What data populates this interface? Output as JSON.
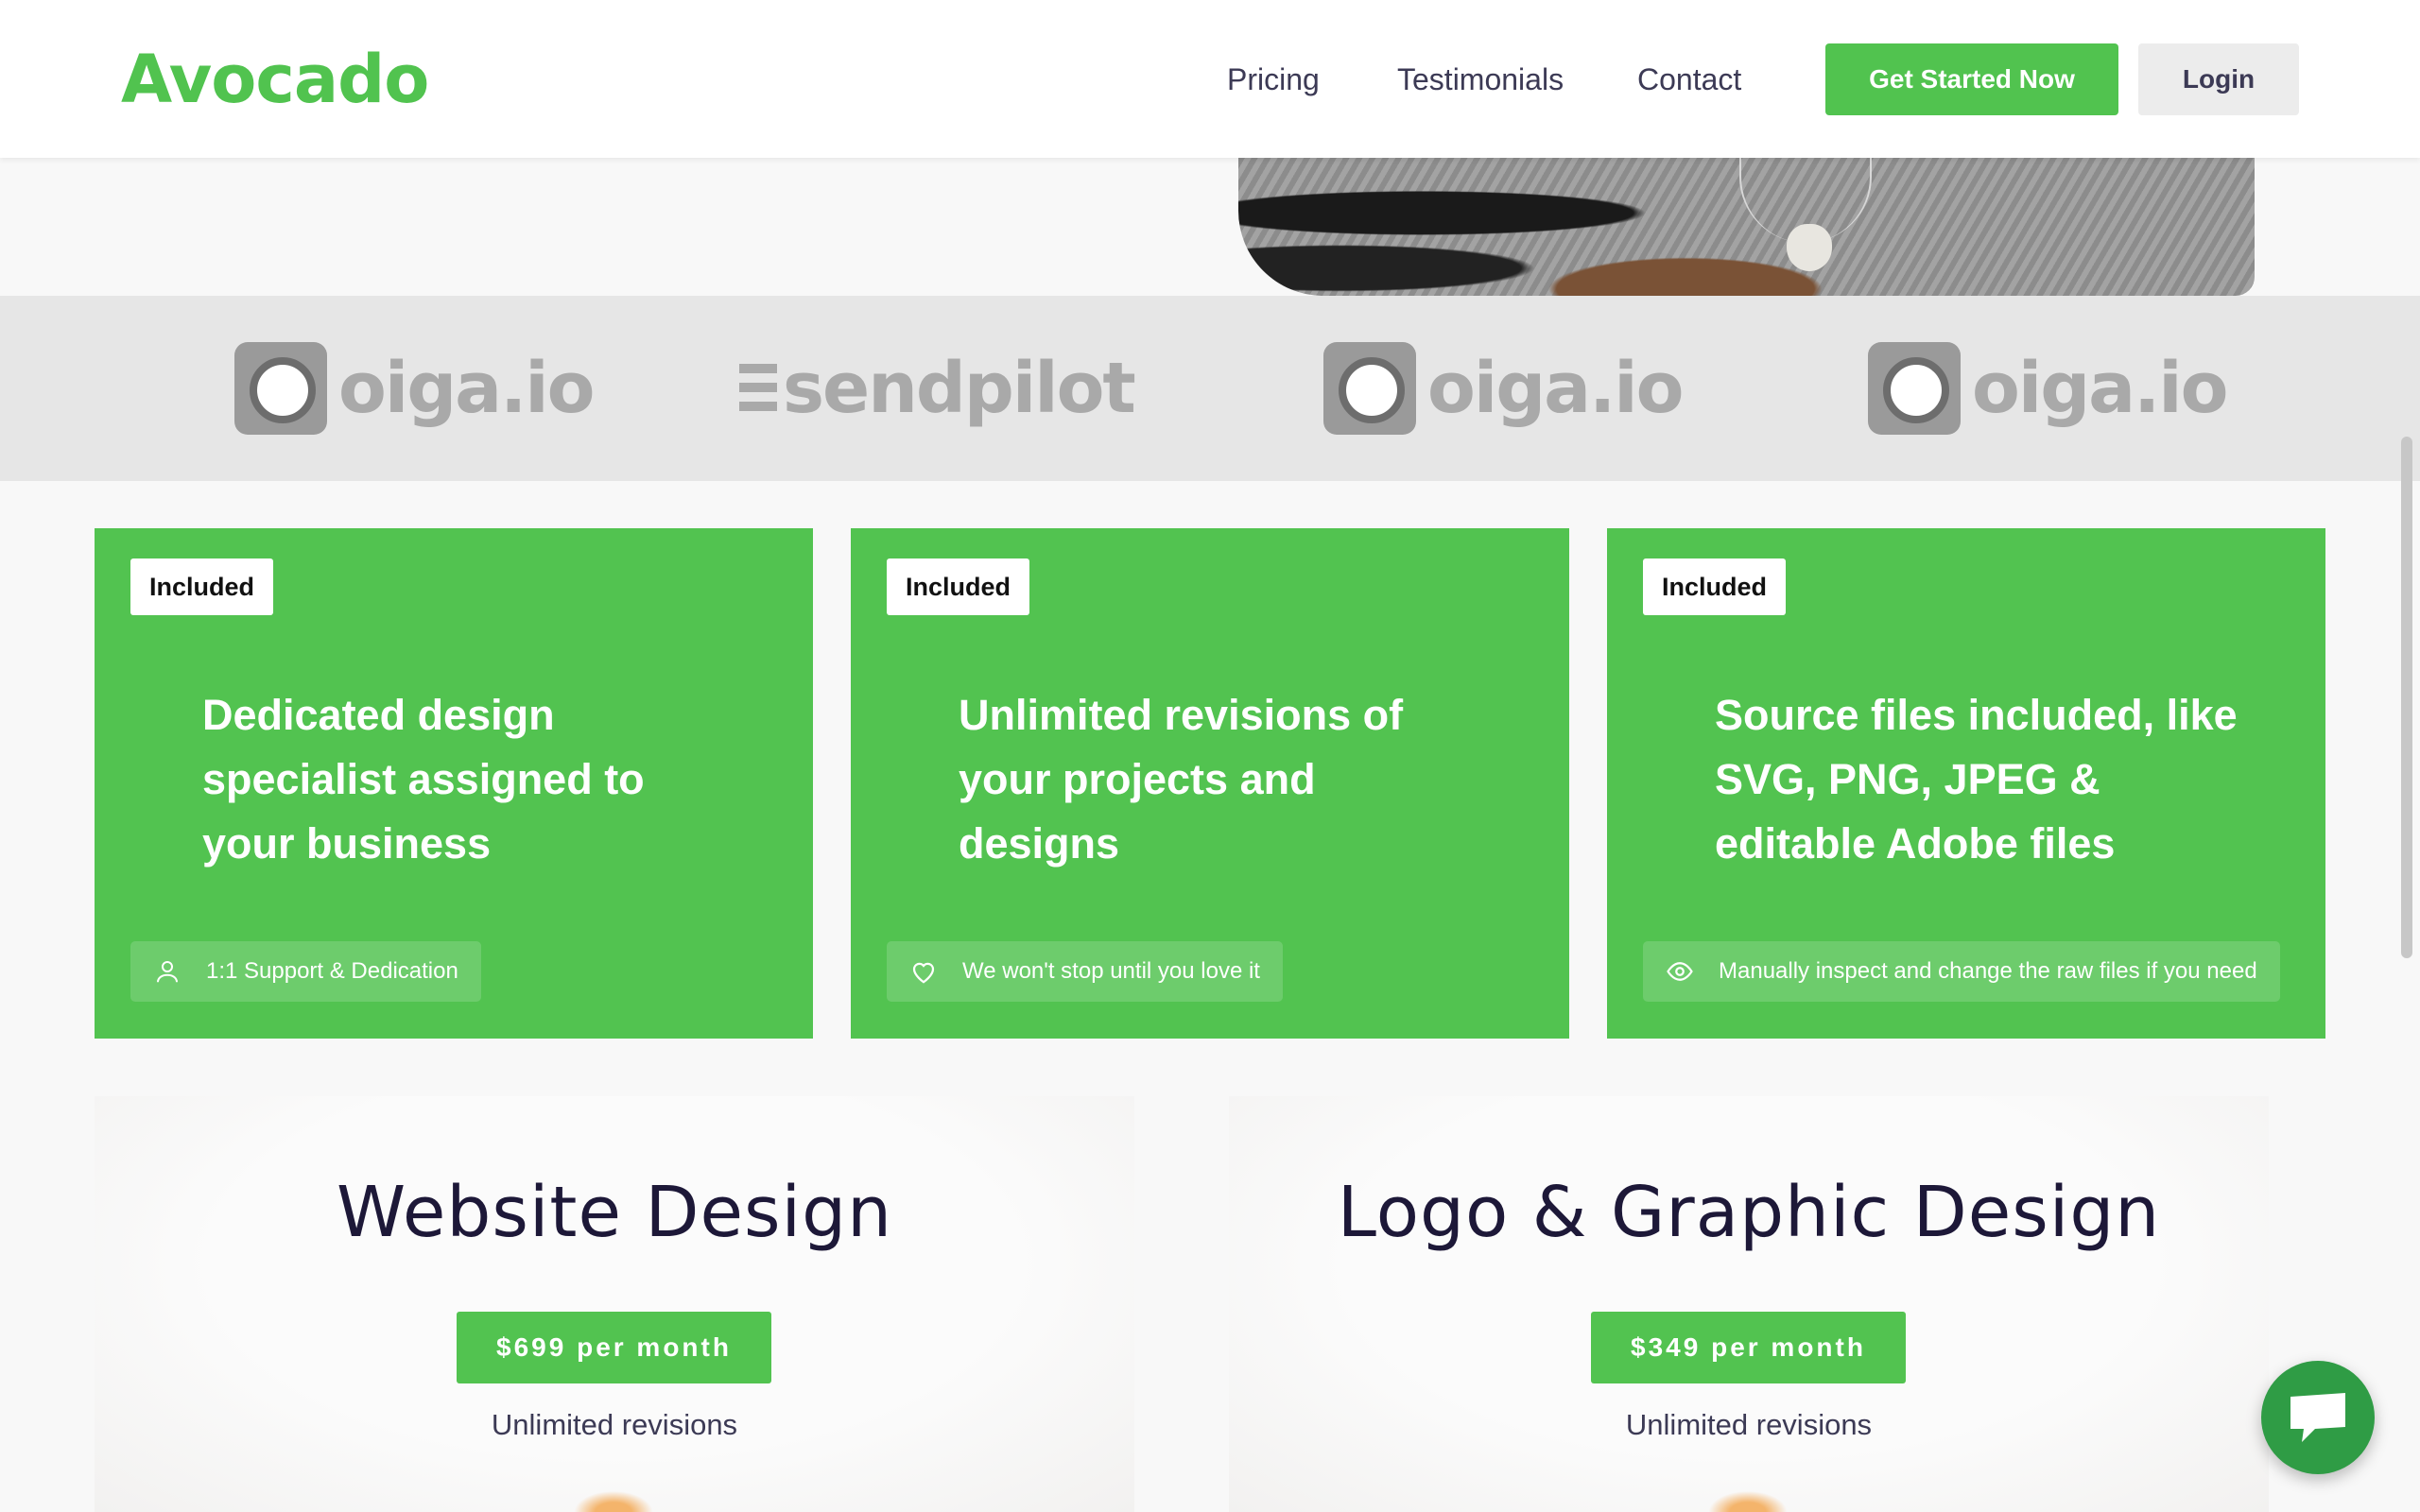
{
  "header": {
    "brand": "Avocado",
    "nav": {
      "pricing": "Pricing",
      "testimonials": "Testimonials",
      "contact": "Contact"
    },
    "cta_label": "Get Started Now",
    "login_label": "Login"
  },
  "logos": [
    {
      "name": "oiga.io"
    },
    {
      "name": "sendpilot"
    },
    {
      "name": "oiga.io"
    },
    {
      "name": "oiga.io"
    }
  ],
  "cards": [
    {
      "badge": "Included",
      "title": "Dedicated design specialist assigned to your business",
      "pill_icon": "user-icon",
      "pill_text": "1:1 Support & Dedication"
    },
    {
      "badge": "Included",
      "title": "Unlimited revisions of your projects and designs",
      "pill_icon": "heart-icon",
      "pill_text": "We won't stop until you love it"
    },
    {
      "badge": "Included",
      "title": "Source files included, like SVG, PNG, JPEG & editable Adobe files",
      "pill_icon": "eye-icon",
      "pill_text": "Manually inspect and change the raw files if you need"
    }
  ],
  "pricing": [
    {
      "title": "Website Design",
      "price": "$699 per month",
      "subtitle": "Unlimited revisions"
    },
    {
      "title": "Logo & Graphic Design",
      "price": "$349 per month",
      "subtitle": "Unlimited revisions"
    }
  ],
  "chat": {
    "icon": "chat-bubble-icon"
  },
  "colors": {
    "brand_green": "#51c34f",
    "card_green": "#52c350",
    "chat_green": "#2f9c45",
    "text_dark": "#1d1838"
  }
}
